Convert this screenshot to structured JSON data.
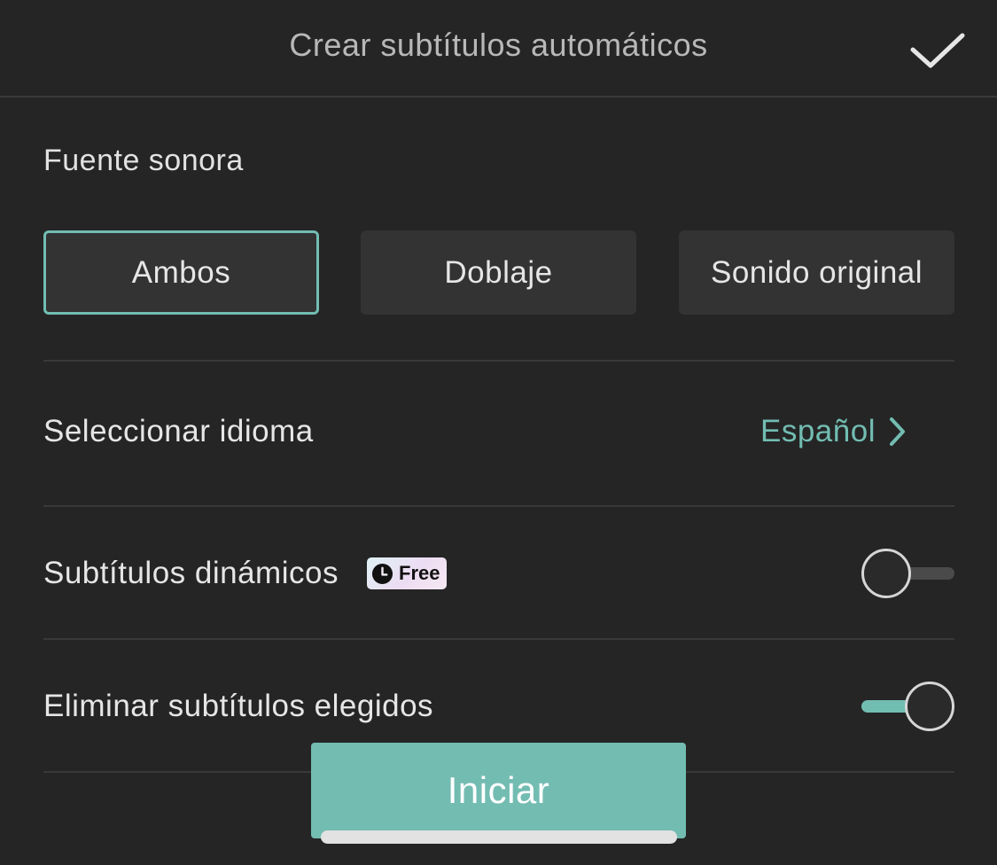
{
  "header": {
    "title": "Crear subtítulos automáticos",
    "confirm_icon": "checkmark-icon"
  },
  "audio_source": {
    "label": "Fuente sonora",
    "options": [
      {
        "label": "Ambos",
        "selected": true
      },
      {
        "label": "Doblaje",
        "selected": false
      },
      {
        "label": "Sonido original",
        "selected": false
      }
    ]
  },
  "language": {
    "label": "Seleccionar idioma",
    "value": "Español",
    "icon": "chevron-right-icon"
  },
  "dynamic_subtitles": {
    "label": "Subtítulos dinámicos",
    "badge": "Free",
    "badge_icon": "clock-icon",
    "enabled": false
  },
  "remove_subtitles": {
    "label": "Eliminar subtítulos elegidos",
    "enabled": true
  },
  "start_button": {
    "label": "Iniciar"
  },
  "colors": {
    "background": "#252525",
    "accent": "#72bdb2",
    "button_bg": "#333333"
  }
}
